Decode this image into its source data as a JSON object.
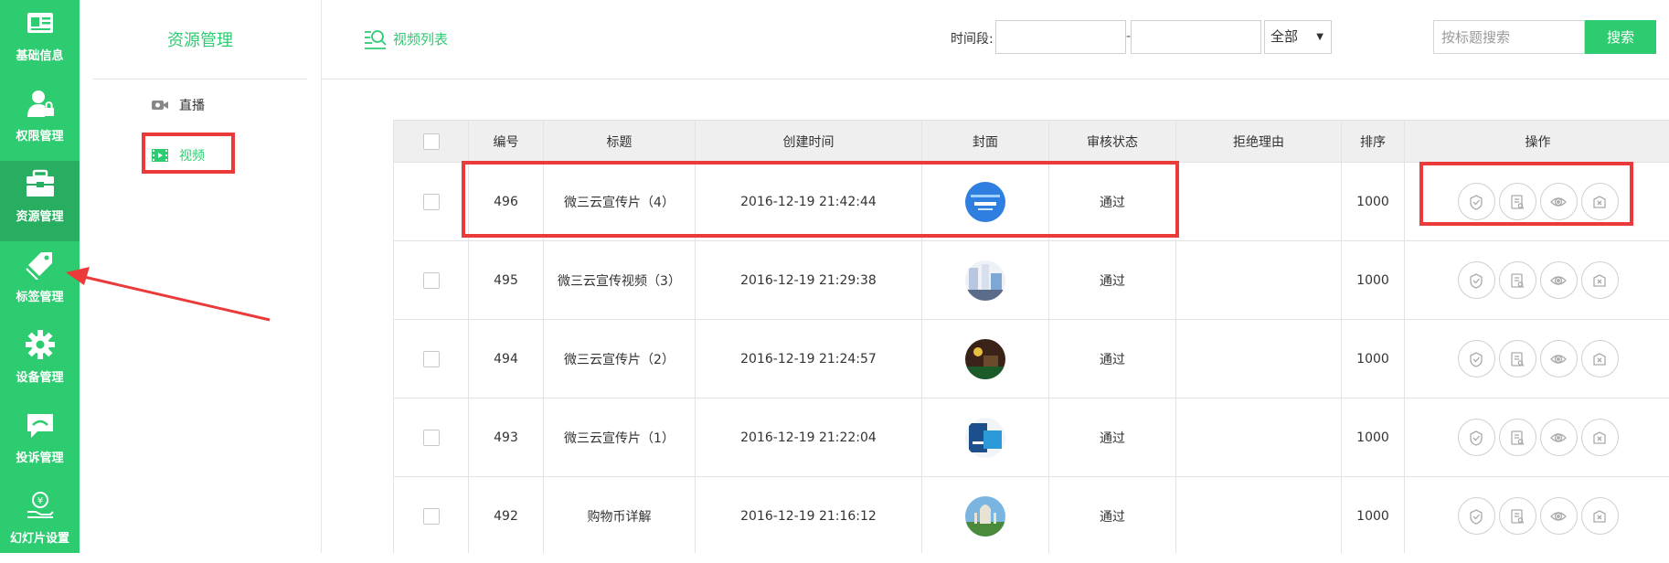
{
  "nav": {
    "items": [
      {
        "label": "基础信息",
        "icon": "id-card-icon"
      },
      {
        "label": "权限管理",
        "icon": "user-lock-icon"
      },
      {
        "label": "资源管理",
        "icon": "toolbox-icon"
      },
      {
        "label": "标签管理",
        "icon": "tag-icon"
      },
      {
        "label": "设备管理",
        "icon": "gear-icon"
      },
      {
        "label": "投诉管理",
        "icon": "chat-bubble-icon"
      },
      {
        "label": "幻灯片设置",
        "icon": "yen-hand-icon"
      }
    ],
    "active_index": 2
  },
  "subnav": {
    "title": "资源管理",
    "items": [
      {
        "label": "直播",
        "icon": "camera-icon"
      },
      {
        "label": "视频",
        "icon": "film-icon"
      }
    ],
    "active_index": 1
  },
  "header": {
    "list_title": "视频列表",
    "period_label": "时间段:",
    "date_separator": "-",
    "date_start_value": "",
    "date_end_value": "",
    "status_selected": "全部",
    "search_placeholder": "按标题搜索",
    "search_button": "搜索"
  },
  "table": {
    "columns": [
      "",
      "编号",
      "标题",
      "创建时间",
      "封面",
      "审核状态",
      "拒绝理由",
      "排序",
      "操作"
    ],
    "rows": [
      {
        "id": "496",
        "title": "微三云宣传片（4）",
        "created": "2016-12-19 21:42:44",
        "status": "通过",
        "reason": "",
        "sort": "1000"
      },
      {
        "id": "495",
        "title": "微三云宣传视频（3）",
        "created": "2016-12-19 21:29:38",
        "status": "通过",
        "reason": "",
        "sort": "1000"
      },
      {
        "id": "494",
        "title": "微三云宣传片（2）",
        "created": "2016-12-19 21:24:57",
        "status": "通过",
        "reason": "",
        "sort": "1000"
      },
      {
        "id": "493",
        "title": "微三云宣传片（1）",
        "created": "2016-12-19 21:22:04",
        "status": "通过",
        "reason": "",
        "sort": "1000"
      },
      {
        "id": "492",
        "title": "购物币详解",
        "created": "2016-12-19 21:16:12",
        "status": "通过",
        "reason": "",
        "sort": "1000"
      }
    ],
    "operations": [
      "approve-icon",
      "edit-doc-icon",
      "view-eye-icon",
      "reject-icon"
    ]
  },
  "colors": {
    "accent": "#2ecc71",
    "nav_active": "#27ae60",
    "highlight": "#ea3a3a"
  }
}
